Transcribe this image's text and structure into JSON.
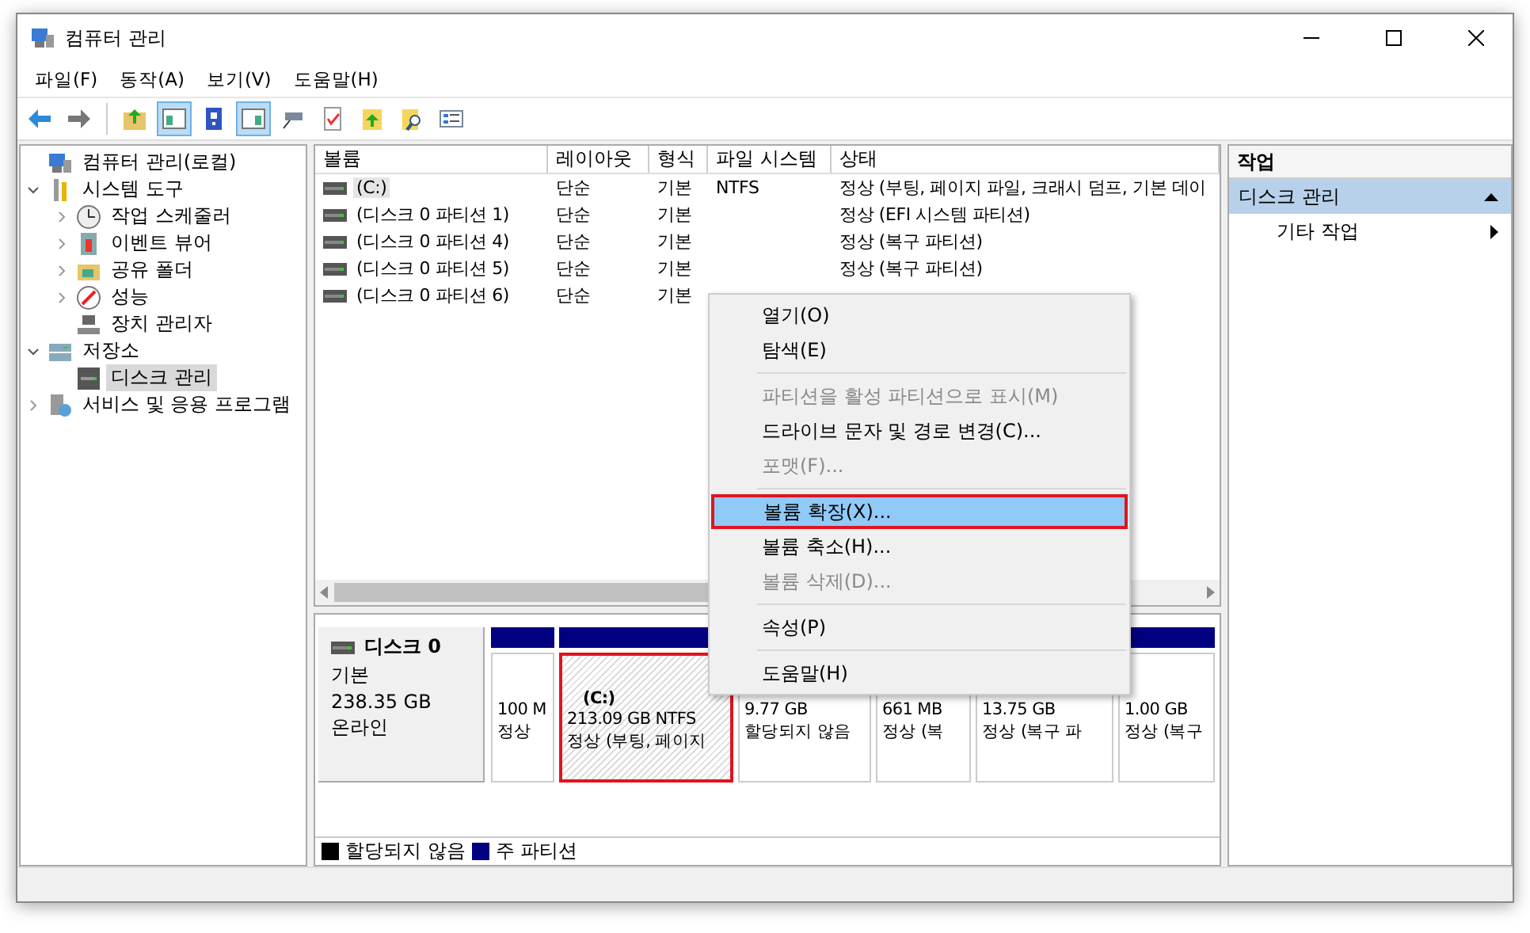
{
  "window": {
    "title": "컴퓨터 관리"
  },
  "menu_bar": [
    "파일(F)",
    "동작(A)",
    "보기(V)",
    "도움말(H)"
  ],
  "toolbar": [
    {
      "kind": "back",
      "pressed": false
    },
    {
      "kind": "forward",
      "pressed": false
    },
    {
      "kind": "separator"
    },
    {
      "kind": "up",
      "pressed": false
    },
    {
      "kind": "tree",
      "pressed": true
    },
    {
      "kind": "help",
      "pressed": false
    },
    {
      "kind": "actions",
      "pressed": true
    },
    {
      "kind": "connect",
      "pressed": false
    },
    {
      "kind": "check",
      "pressed": false
    },
    {
      "kind": "export",
      "pressed": false
    },
    {
      "kind": "find",
      "pressed": false
    },
    {
      "kind": "properties",
      "pressed": false
    }
  ],
  "tree": [
    {
      "label": "컴퓨터 관리(로컬)",
      "selected": false,
      "children": [
        {
          "label": "시스템 도구",
          "expanded": true,
          "selected": false,
          "children": [
            {
              "label": "작업 스케줄러",
              "expanded": false,
              "selected": false
            },
            {
              "label": "이벤트 뷰어",
              "expanded": false,
              "selected": false
            },
            {
              "label": "공유 폴더",
              "expanded": false,
              "selected": false
            },
            {
              "label": "성능",
              "expanded": false,
              "selected": false
            },
            {
              "label": "장치 관리자",
              "selected": false
            }
          ]
        },
        {
          "label": "저장소",
          "expanded": true,
          "selected": false,
          "children": [
            {
              "label": "디스크 관리",
              "selected": true
            }
          ]
        },
        {
          "label": "서비스 및 응용 프로그램",
          "expanded": false,
          "selected": false
        }
      ]
    }
  ],
  "volume_table": {
    "columns": [
      "볼륨",
      "레이아웃",
      "형식",
      "파일 시스템",
      "상태"
    ],
    "rows": [
      {
        "cells": [
          "(C:)",
          "단순",
          "기본",
          "NTFS",
          "정상 (부팅, 페이지 파일, 크래시 덤프, 기본 데이"
        ],
        "selected": true
      },
      {
        "cells": [
          "(디스크 0 파티션 1)",
          "단순",
          "기본",
          "",
          "정상 (EFI 시스템 파티션)"
        ],
        "selected": false
      },
      {
        "cells": [
          "(디스크 0 파티션 4)",
          "단순",
          "기본",
          "",
          "정상 (복구 파티션)"
        ],
        "selected": false
      },
      {
        "cells": [
          "(디스크 0 파티션 5)",
          "단순",
          "기본",
          "",
          "정상 (복구 파티션)"
        ],
        "selected": false
      },
      {
        "cells": [
          "(디스크 0 파티션 6)",
          "단순",
          "기본"
        ],
        "selected": false
      }
    ]
  },
  "disk": {
    "name": "디스크 0",
    "type": "기본",
    "size": "238.35 GB",
    "status": "온라인",
    "partitions": [
      {
        "kind": "primary",
        "size": "100 M",
        "status": "정상",
        "selected": false
      },
      {
        "kind": "primary",
        "label": "(C:)",
        "size": "213.09 GB NTFS",
        "status": "정상 (부팅, 페이지",
        "selected": true
      },
      {
        "size": "9.77 GB",
        "status": "할당되지 않음",
        "selected": false
      },
      {
        "size": "661 MB",
        "status": "정상 (복",
        "selected": false
      },
      {
        "size": "13.75 GB",
        "status": "정상 (복구 파",
        "selected": false
      },
      {
        "kind": "primary",
        "size": "1.00 GB",
        "status": "정상 (복구",
        "selected": false
      }
    ]
  },
  "legend": [
    {
      "label": "할당되지 않음",
      "color": "#000000"
    },
    {
      "label": "주 파티션",
      "color": "#000080"
    }
  ],
  "actions": {
    "title": "작업",
    "sections": [
      {
        "label": "디스크 관리",
        "expanded": true,
        "items": [
          "기타 작업"
        ]
      }
    ]
  },
  "context_menu": [
    {
      "kind": "item",
      "label": "열기(O)",
      "disabled": false,
      "selected": false
    },
    {
      "kind": "item",
      "label": "탐색(E)",
      "disabled": false,
      "selected": false
    },
    {
      "kind": "separator"
    },
    {
      "kind": "item",
      "label": "파티션을 활성 파티션으로 표시(M)",
      "disabled": true,
      "selected": false
    },
    {
      "kind": "item",
      "label": "드라이브 문자 및 경로 변경(C)...",
      "disabled": false,
      "selected": false
    },
    {
      "kind": "item",
      "label": "포맷(F)...",
      "disabled": true,
      "selected": false
    },
    {
      "kind": "separator"
    },
    {
      "kind": "item",
      "label": "볼륨 확장(X)...",
      "disabled": false,
      "selected": true
    },
    {
      "kind": "item",
      "label": "볼륨 축소(H)...",
      "disabled": false,
      "selected": false
    },
    {
      "kind": "item",
      "label": "볼륨 삭제(D)...",
      "disabled": true,
      "selected": false
    },
    {
      "kind": "separator"
    },
    {
      "kind": "item",
      "label": "속성(P)",
      "disabled": false,
      "selected": false
    },
    {
      "kind": "separator"
    },
    {
      "kind": "item",
      "label": "도움말(H)",
      "disabled": false,
      "selected": false
    }
  ]
}
